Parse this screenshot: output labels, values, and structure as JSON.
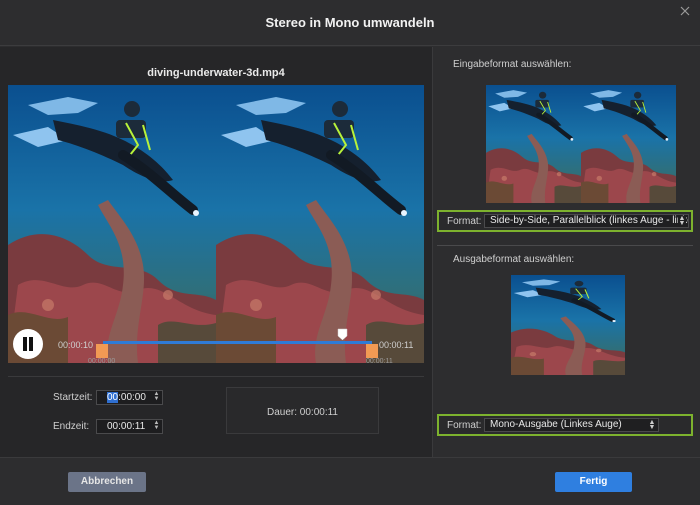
{
  "dialog": {
    "title": "Stereo in Mono umwandeln"
  },
  "player": {
    "file_name": "diving-underwater-3d.mp4",
    "current_left": "00:00:10",
    "current_right": "00:00:11",
    "range_start": "00:00:00",
    "range_end": "00:00:11"
  },
  "trim": {
    "start_label": "Startzeit:",
    "start_value_sel": "00",
    "start_value_rest": ":00:00:00",
    "end_label": "Endzeit:",
    "end_value": "00:00:11",
    "duration_label": "Dauer:",
    "duration_value": "00:00:11"
  },
  "input": {
    "section_title": "Eingabeformat auswählen:",
    "format_label": "Format:",
    "format_value": "Side-by-Side, Parallelblick (linkes Auge - linkes"
  },
  "output": {
    "section_title": "Ausgabeformat auswählen:",
    "format_label": "Format:",
    "format_value": "Mono-Ausgabe (Linkes Auge)"
  },
  "footer": {
    "cancel_label": "Abbrechen",
    "done_label": "Fertig"
  },
  "colors": {
    "accent_blue": "#2f7fe0",
    "highlight_green": "#7db22e",
    "trim_handle": "#f19a54"
  },
  "icons": {
    "close": "close-icon",
    "pause": "pause-icon",
    "playhead": "playhead-marker-icon",
    "spinner": "spinner-arrows-icon",
    "chevron": "chevron-updown-icon"
  }
}
